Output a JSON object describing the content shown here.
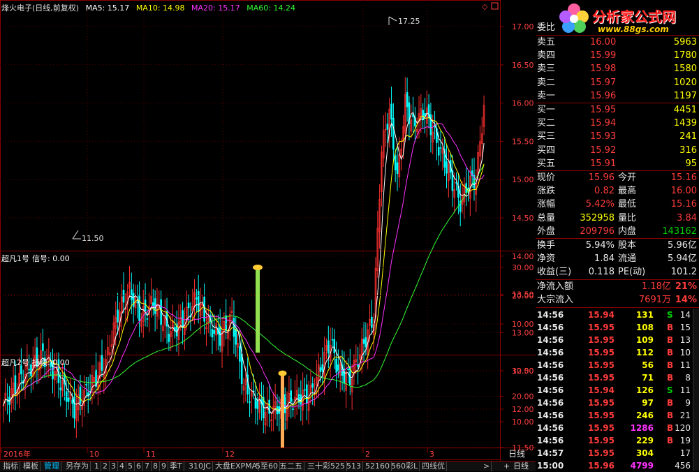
{
  "header": {
    "stock_title": "烽火电子(日线,前复权)",
    "ma5": "MA5: 15.17",
    "ma10": "MA10: 14.98",
    "ma20": "MA20: 15.17",
    "ma60": "MA60: 14.24"
  },
  "colors": {
    "ma5": "#ffffff",
    "ma10": "#ffff00",
    "ma20": "#ff33ff",
    "ma60": "#33ff33",
    "up": "#ff3030",
    "down": "#00ffff"
  },
  "price_axis": [
    "17.00",
    "16.50",
    "16.00",
    "15.50",
    "15.00",
    "14.50",
    "14.00",
    "13.50",
    "13.00",
    "12.50",
    "12.00",
    "11.50"
  ],
  "annotations": {
    "high": "17.25",
    "low": "11.50"
  },
  "indicator1": {
    "name": "超凡1号",
    "field": "信号: 0.00",
    "axis": [
      "30.00",
      "20.00",
      "10.00"
    ],
    "bar_value": 30
  },
  "indicator2": {
    "name": "超凡2号",
    "field": "持续: 0.00",
    "axis": [
      "30.00",
      "20.00",
      "10.00"
    ],
    "bar_value": 29
  },
  "time_axis": [
    "2016年",
    "10",
    "11",
    "12",
    "2",
    "3"
  ],
  "period_label": "日线",
  "tabs": [
    "指标",
    "模板",
    "管理",
    "另存为",
    "1",
    "2",
    "3",
    "4",
    "5",
    "6",
    "7",
    "8",
    "9",
    "季T",
    "310JC",
    "大盘EXPMA",
    "5至60",
    "五二五",
    "三十彩525",
    "513",
    "52160",
    "560彩L",
    "四线优"
  ],
  "tab_controls": [
    "+",
    "日线",
    ">"
  ],
  "watermark": {
    "brand": "分析家公式网",
    "url": "www.88gs.com"
  },
  "order_book": {
    "ratio_label": "委比",
    "asks": [
      {
        "label": "卖五",
        "price": "16.00",
        "vol": "5963"
      },
      {
        "label": "卖四",
        "price": "15.99",
        "vol": "1780"
      },
      {
        "label": "卖三",
        "price": "15.98",
        "vol": "1580"
      },
      {
        "label": "卖二",
        "price": "15.97",
        "vol": "1020"
      },
      {
        "label": "卖一",
        "price": "15.96",
        "vol": "1197"
      }
    ],
    "bids": [
      {
        "label": "买一",
        "price": "15.95",
        "vol": "4451"
      },
      {
        "label": "买二",
        "price": "15.94",
        "vol": "1439"
      },
      {
        "label": "买三",
        "price": "15.93",
        "vol": "241"
      },
      {
        "label": "买四",
        "price": "15.92",
        "vol": "316"
      },
      {
        "label": "买五",
        "price": "15.91",
        "vol": "95"
      }
    ]
  },
  "quote": [
    {
      "l1": "现价",
      "v1": "15.96",
      "l2": "今开",
      "v2": "15.16",
      "c1": "red",
      "c2": "red"
    },
    {
      "l1": "涨跌",
      "v1": "0.82",
      "l2": "最高",
      "v2": "16.00",
      "c1": "red",
      "c2": "red"
    },
    {
      "l1": "涨幅",
      "v1": "5.42%",
      "l2": "最低",
      "v2": "15.16",
      "c1": "red",
      "c2": "red"
    },
    {
      "l1": "总量",
      "v1": "352958",
      "l2": "量比",
      "v2": "3.84",
      "c1": "yel",
      "c2": "red"
    },
    {
      "l1": "外盘",
      "v1": "209796",
      "l2": "内盘",
      "v2": "143162",
      "c1": "red",
      "c2": "grn"
    }
  ],
  "finance": [
    {
      "l1": "换手",
      "v1": "5.94%",
      "l2": "股本",
      "v2": "5.96亿"
    },
    {
      "l1": "净资",
      "v1": "1.84",
      "l2": "流通",
      "v2": "5.94亿"
    },
    {
      "l1": "收益(三)",
      "v1": "0.118",
      "l2": "PE(动)",
      "v2": "101.2"
    }
  ],
  "flow": [
    {
      "label": "净流入额",
      "value": "1.18亿",
      "pct": "21%"
    },
    {
      "label": "大宗流入",
      "value": "7691万",
      "pct": "14%"
    }
  ],
  "trades": [
    {
      "t": "14:56",
      "p": "15.94",
      "v": "131",
      "s": "S",
      "n": "14"
    },
    {
      "t": "14:56",
      "p": "15.95",
      "v": "108",
      "s": "B",
      "n": "15"
    },
    {
      "t": "14:56",
      "p": "15.95",
      "v": "109",
      "s": "B",
      "n": "13"
    },
    {
      "t": "14:56",
      "p": "15.95",
      "v": "112",
      "s": "B",
      "n": "10"
    },
    {
      "t": "14:56",
      "p": "15.95",
      "v": "56",
      "s": "B",
      "n": "11"
    },
    {
      "t": "14:56",
      "p": "15.95",
      "v": "71",
      "s": "B",
      "n": "8"
    },
    {
      "t": "14:56",
      "p": "15.94",
      "v": "126",
      "s": "S",
      "n": "11"
    },
    {
      "t": "14:56",
      "p": "15.95",
      "v": "97",
      "s": "B",
      "n": "9"
    },
    {
      "t": "14:56",
      "p": "15.95",
      "v": "246",
      "s": "B",
      "n": "21"
    },
    {
      "t": "14:56",
      "p": "15.95",
      "v": "1286",
      "s": "B",
      "n": "120"
    },
    {
      "t": "14:56",
      "p": "15.95",
      "v": "229",
      "s": "B",
      "n": "19"
    },
    {
      "t": "14:57",
      "p": "15.95",
      "v": "304",
      "s": "",
      "n": "17"
    },
    {
      "t": "15:00",
      "p": "15.96",
      "v": "4799",
      "s": "",
      "n": "456"
    }
  ]
}
